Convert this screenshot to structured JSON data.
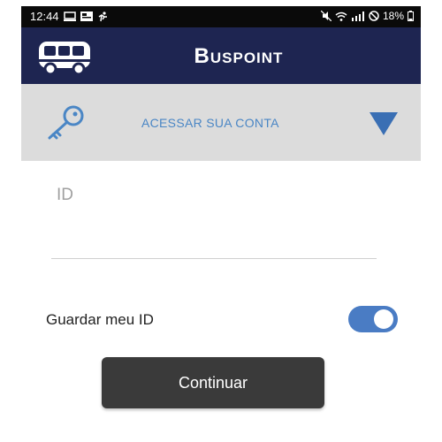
{
  "status_bar": {
    "time": "12:44",
    "battery": "18%"
  },
  "app_bar": {
    "title": "Buspoint",
    "logo_icon": "bus-icon"
  },
  "account_bar": {
    "label": "ACESSAR SUA CONTA",
    "icon": "key-icon",
    "expand_icon": "chevron-down-icon"
  },
  "form": {
    "id_placeholder": "ID",
    "id_value": "",
    "remember_label": "Guardar meu ID",
    "remember_enabled": true,
    "continue_label": "Continuar"
  },
  "colors": {
    "app_bar_bg": "#1e2551",
    "account_bar_bg": "#dcdcdc",
    "accent": "#4a7cc4",
    "button_bg": "#3a3a3a"
  }
}
